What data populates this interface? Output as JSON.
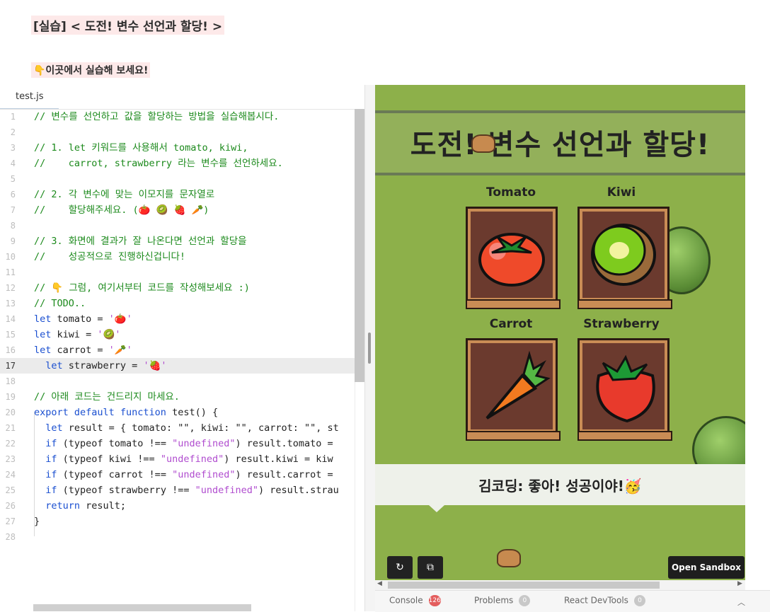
{
  "header": {
    "title": "[실습] < 도전! 변수 선언과 할당! >",
    "subtitle": "👇이곳에서 실습해 보세요!"
  },
  "editor": {
    "file_tab": "test.js",
    "lines": [
      {
        "n": "1",
        "text": "// 변수를 선언하고 값을 할당하는 방법을 실습해봅시다."
      },
      {
        "n": "2",
        "text": ""
      },
      {
        "n": "3",
        "text": "// 1. let 키워드를 사용해서 tomato, kiwi,"
      },
      {
        "n": "4",
        "text": "//    carrot, strawberry 라는 변수를 선언하세요."
      },
      {
        "n": "5",
        "text": ""
      },
      {
        "n": "6",
        "text": "// 2. 각 변수에 맞는 이모지를 문자열로"
      },
      {
        "n": "7",
        "text": "//    할당해주세요. (🍅 🥝 🍓 🥕)"
      },
      {
        "n": "8",
        "text": ""
      },
      {
        "n": "9",
        "text": "// 3. 화면에 결과가 잘 나온다면 선언과 할당을"
      },
      {
        "n": "10",
        "text": "//    성공적으로 진행하신겁니다!"
      },
      {
        "n": "11",
        "text": ""
      },
      {
        "n": "12",
        "text": "// 👇 그럼, 여기서부터 코드를 작성해보세요 :)"
      },
      {
        "n": "13",
        "text": "// TODO.."
      },
      {
        "n": "14",
        "kw": "let",
        "rest": " tomato = ",
        "str": "'🍅'"
      },
      {
        "n": "15",
        "kw": "let",
        "rest": " kiwi = ",
        "str": "'🥝'"
      },
      {
        "n": "16",
        "kw": "let",
        "rest": " carrot = ",
        "str": "'🥕'"
      },
      {
        "n": "17",
        "kw": "  let",
        "rest": " strawberry = ",
        "str": "'🍓'"
      },
      {
        "n": "18",
        "text": ""
      },
      {
        "n": "19",
        "text": "// 아래 코드는 건드리지 마세요."
      },
      {
        "n": "20",
        "kw": "export default function",
        "rest": " test() {",
        "str": ""
      },
      {
        "n": "21",
        "kw": "  let",
        "rest": " result = { tomato: \"\", kiwi: \"\", carrot: \"\", st",
        "str": ""
      },
      {
        "n": "22",
        "kw": "  if",
        "rest": " (typeof tomato !== ",
        "str": "\"undefined\"",
        "after": ") result.tomato ="
      },
      {
        "n": "23",
        "kw": "  if",
        "rest": " (typeof kiwi !== ",
        "str": "\"undefined\"",
        "after": ") result.kiwi = kiw"
      },
      {
        "n": "24",
        "kw": "  if",
        "rest": " (typeof carrot !== ",
        "str": "\"undefined\"",
        "after": ") result.carrot ="
      },
      {
        "n": "25",
        "kw": "  if",
        "rest": " (typeof strawberry !== ",
        "str": "\"undefined\"",
        "after": ") result.strau"
      },
      {
        "n": "26",
        "kw": "  return",
        "rest": " result;",
        "str": ""
      },
      {
        "n": "27",
        "text": "}"
      },
      {
        "n": "28",
        "text": ""
      }
    ]
  },
  "preview": {
    "banner": "도전! 변수 선언과 할당!",
    "items": [
      {
        "label": "Tomato"
      },
      {
        "label": "Kiwi"
      },
      {
        "label": "Carrot"
      },
      {
        "label": "Strawberry"
      }
    ],
    "dialog": "김코딩: 좋아! 성공이야!🥳",
    "open_sandbox": "Open Sandbox",
    "refresh_icon": "refresh-icon",
    "external_icon": "external-link-icon"
  },
  "console_bar": {
    "tabs": [
      {
        "label": "Console",
        "badge": "126"
      },
      {
        "label": "Problems",
        "badge": "0"
      },
      {
        "label": "React DevTools",
        "badge": "0"
      }
    ]
  },
  "colors": {
    "header_bg": "#fde9e9",
    "comment": "#1c8a1c",
    "keyword": "#1a4fd0",
    "string": "#b04ccf",
    "grass": "#8db04a"
  }
}
